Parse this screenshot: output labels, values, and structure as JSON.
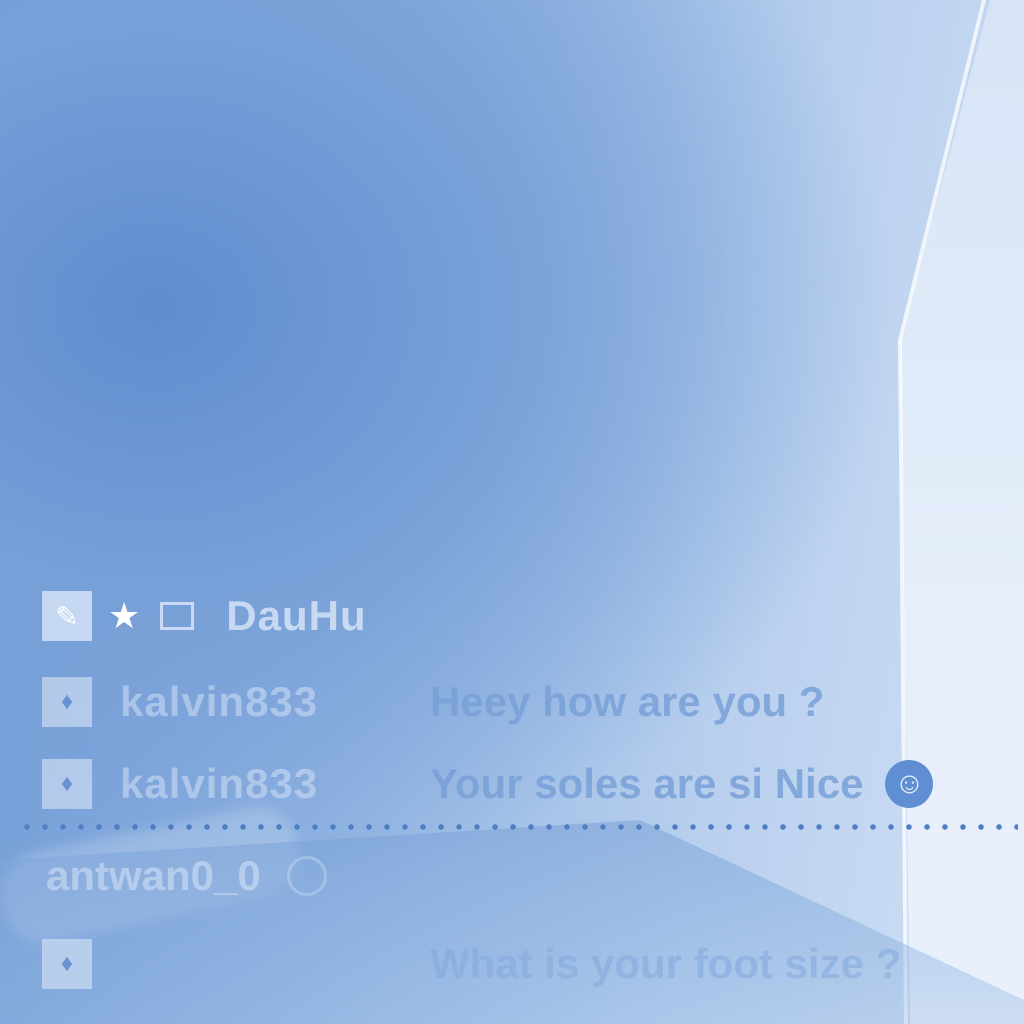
{
  "chat": {
    "rows": [
      {
        "username": "DauHu",
        "badges": [
          "brush-icon",
          "star-icon",
          "picture-icon"
        ],
        "status_icon": "heart-icon"
      },
      {
        "username": "kalvin833",
        "badge": "drop-icon",
        "message": "Heey how are you ?"
      },
      {
        "username": "kalvin833",
        "badge": "drop-icon",
        "message": "Your soles are si Nice",
        "emoji": "☺"
      },
      {
        "username": "antwan0_0",
        "status_icon": "clock-icon"
      },
      {
        "badge": "drop-icon",
        "message": "What is your foot size ?"
      }
    ]
  },
  "colors": {
    "accent": "#5f8fd2",
    "divider": "#4f7fc3"
  }
}
